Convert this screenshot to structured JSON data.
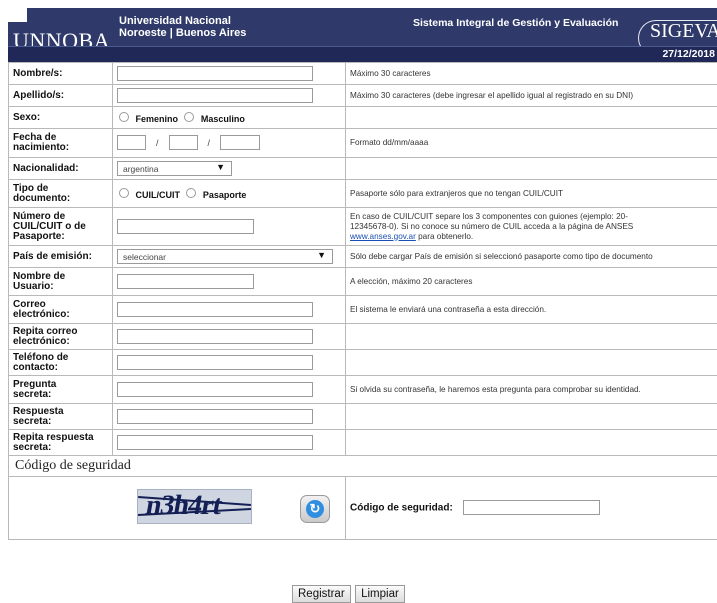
{
  "header": {
    "brand": "UNNOBA",
    "university_line1": "Universidad Nacional",
    "university_line2": "Noroeste | Buenos Aires",
    "system_title": "Sistema Integral de Gestión y Evaluación",
    "logo_text": "SIGEVA",
    "date": "27/12/2018"
  },
  "form": {
    "rows": {
      "nombre": {
        "label": "Nombre/s:",
        "hint": "Máximo 30 caracteres"
      },
      "apellido": {
        "label": "Apellido/s:",
        "hint": "Máximo 30 caracteres (debe ingresar el apellido igual al registrado en su DNI)"
      },
      "sexo": {
        "label": "Sexo:",
        "options": [
          "Femenino",
          "Masculino"
        ]
      },
      "fecha": {
        "label_line1": "Fecha de",
        "label_line2": "nacimiento:",
        "hint": "Formato dd/mm/aaaa",
        "sep": "/"
      },
      "nacionalidad": {
        "label": "Nacionalidad:",
        "selected": "argentina"
      },
      "tipo_doc": {
        "label_line1": "Tipo de",
        "label_line2": "documento:",
        "options": [
          "CUIL/CUIT",
          "Pasaporte"
        ],
        "hint": "Pasaporte sólo para extranjeros que no tengan CUIL/CUIT"
      },
      "numero": {
        "label_line1": "Número de",
        "label_line2": "CUIL/CUIT o de",
        "label_line3": "Pasaporte:",
        "hint_line1": "En caso de CUIL/CUIT separe los 3 componentes con guiones (ejemplo: 20-",
        "hint_line2": "12345678-0). Si no conoce su número de CUIL acceda a la página de ANSES",
        "hint_link": "www.anses.gov.ar",
        "hint_tail": " para obtenerlo."
      },
      "pais": {
        "label": "País de emisión:",
        "selected": "seleccionar",
        "hint": "Sólo debe cargar País de emisión si seleccionó pasaporte como tipo de documento"
      },
      "usuario": {
        "label_line1": "Nombre de",
        "label_line2": "Usuario:",
        "hint": "A elección, máximo 20 caracteres"
      },
      "correo": {
        "label_line1": "Correo",
        "label_line2": "electrónico:",
        "hint": "El sistema le enviará una contraseña a esta dirección."
      },
      "repita_correo": {
        "label_line1": "Repita correo",
        "label_line2": "electrónico:"
      },
      "telefono": {
        "label_line1": "Teléfono de",
        "label_line2": "contacto:"
      },
      "pregunta": {
        "label_line1": "Pregunta",
        "label_line2": "secreta:",
        "hint": "Si olvida su contraseña, le haremos esta pregunta para comprobar su identidad."
      },
      "respuesta": {
        "label_line1": "Respuesta",
        "label_line2": "secreta:"
      },
      "repita_respuesta": {
        "label_line1": "Repita respuesta",
        "label_line2": "secreta:"
      }
    },
    "security": {
      "section_title": "Código de seguridad",
      "captcha_text": "n3h4rt",
      "code_label": "Código de seguridad:"
    },
    "buttons": {
      "submit": "Registrar",
      "clear": "Limpiar"
    }
  }
}
